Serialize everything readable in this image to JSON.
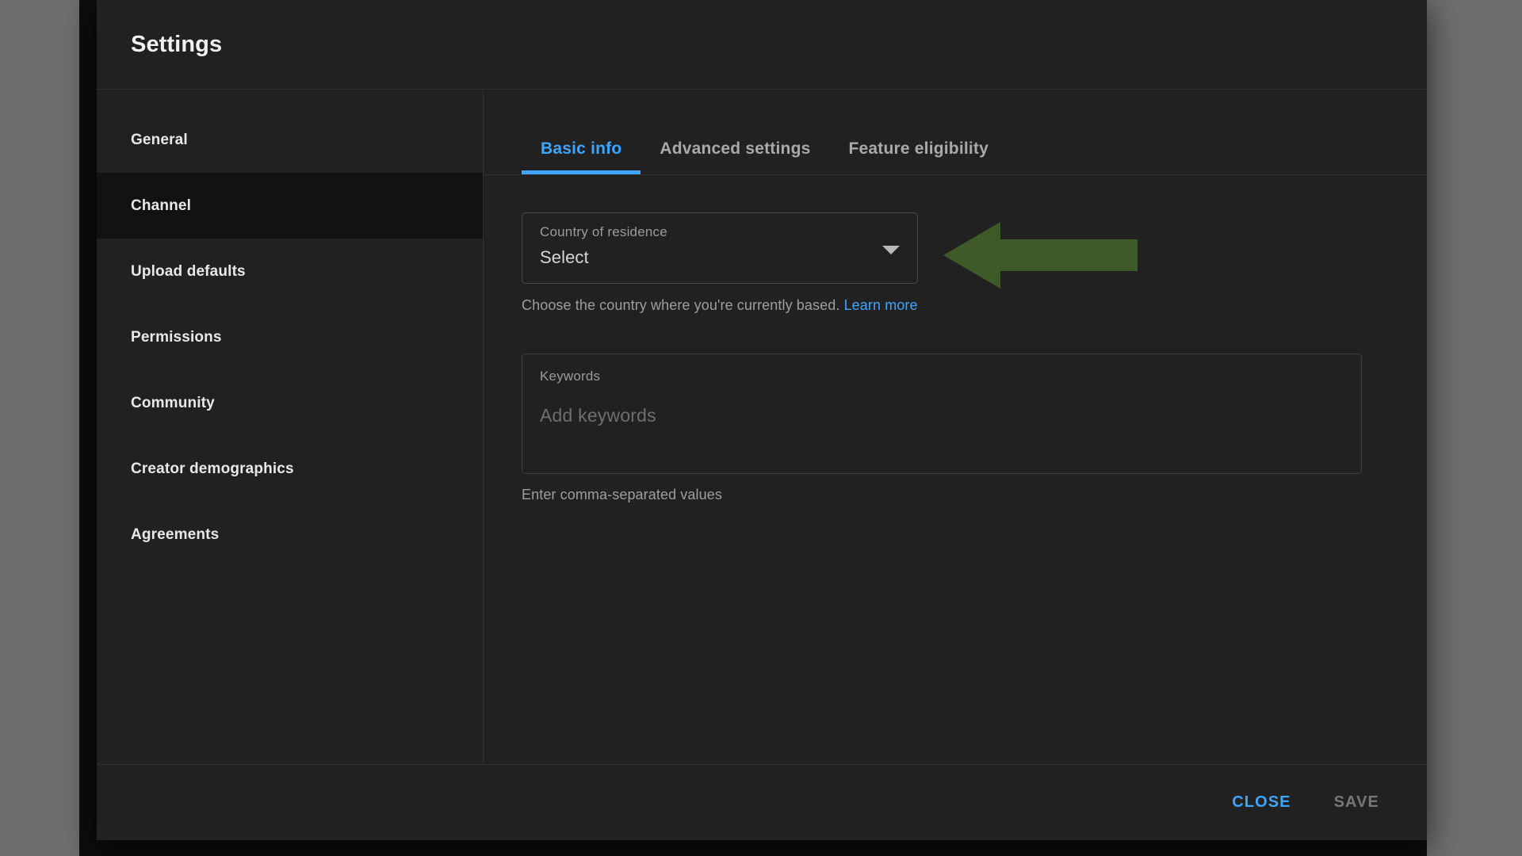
{
  "dialog": {
    "title": "Settings"
  },
  "sidebar": {
    "items": [
      {
        "label": "General",
        "active": false
      },
      {
        "label": "Channel",
        "active": true
      },
      {
        "label": "Upload defaults",
        "active": false
      },
      {
        "label": "Permissions",
        "active": false
      },
      {
        "label": "Community",
        "active": false
      },
      {
        "label": "Creator demographics",
        "active": false
      },
      {
        "label": "Agreements",
        "active": false
      }
    ]
  },
  "tabs": [
    {
      "label": "Basic info",
      "active": true
    },
    {
      "label": "Advanced settings",
      "active": false
    },
    {
      "label": "Feature eligibility",
      "active": false
    }
  ],
  "basic_info": {
    "country_field": {
      "label": "Country of residence",
      "value": "Select",
      "icon": "chevron-down-icon"
    },
    "country_helper": {
      "text": "Choose the country where you're currently based.",
      "link": "Learn more"
    },
    "keywords_field": {
      "label": "Keywords",
      "placeholder": "Add keywords",
      "value": ""
    },
    "keywords_helper": "Enter comma-separated values"
  },
  "footer": {
    "close_label": "CLOSE",
    "save_label": "SAVE"
  },
  "annotation": {
    "type": "arrow-left",
    "color": "#3d5a28",
    "target": "country-of-residence-select"
  },
  "colors": {
    "accent": "#3ea6ff",
    "dialog_bg": "#212121",
    "active_item_bg": "#121212",
    "disabled_text": "#777777",
    "annotation_green": "#3d5a28"
  }
}
